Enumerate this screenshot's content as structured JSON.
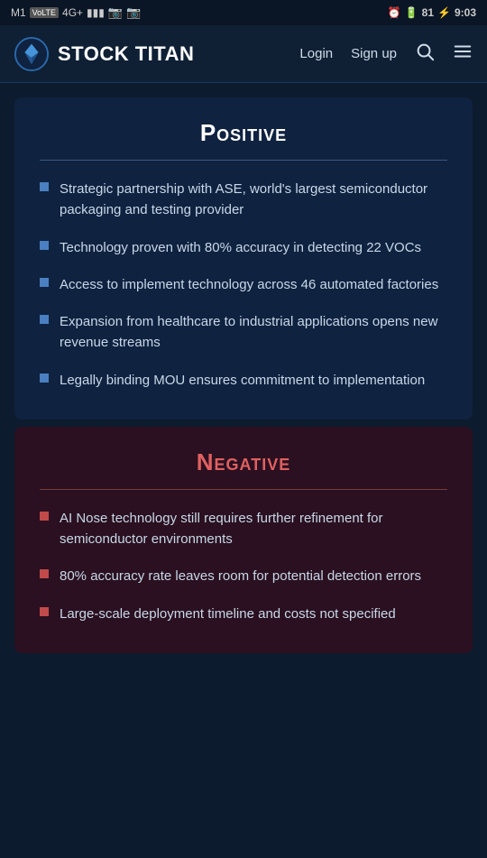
{
  "statusBar": {
    "left": "M1 VoLTE 4G+",
    "icons": "signal",
    "right": "9:03",
    "battery": "81"
  },
  "navbar": {
    "logoText": "STOCK TITAN",
    "loginLabel": "Login",
    "signupLabel": "Sign up"
  },
  "positiveSectionTitle": "Positive",
  "positiveItems": [
    "Strategic partnership with ASE, world's largest semiconductor packaging and testing provider",
    "Technology proven with 80% accuracy in detecting 22 VOCs",
    "Access to implement technology across 46 automated factories",
    "Expansion from healthcare to industrial applications opens new revenue streams",
    "Legally binding MOU ensures commitment to implementation"
  ],
  "negativeSectionTitle": "Negative",
  "negativeItems": [
    "AI Nose technology still requires further refinement for semiconductor environments",
    "80% accuracy rate leaves room for potential detection errors",
    "Large-scale deployment timeline and costs not specified"
  ]
}
